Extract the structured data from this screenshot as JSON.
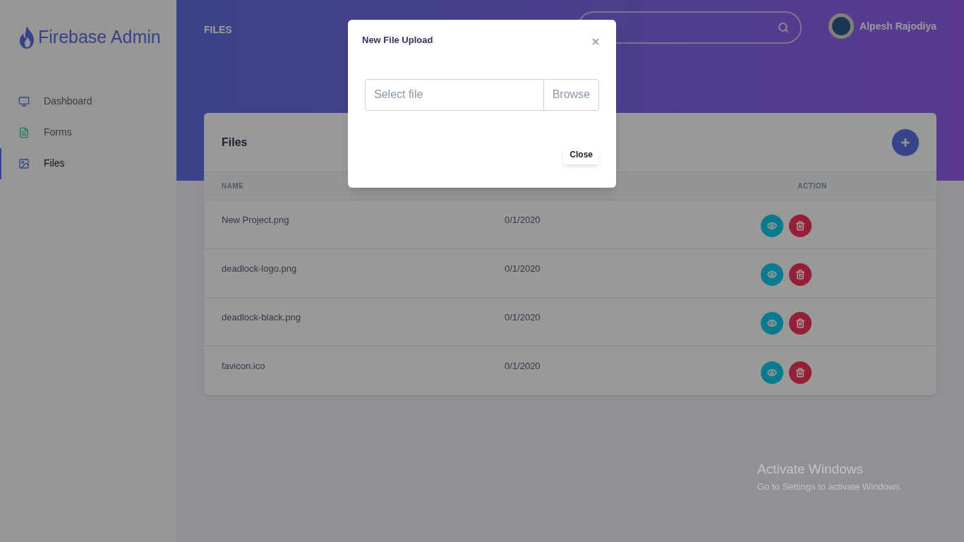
{
  "sidebar": {
    "brand": "Firebase Admin",
    "items": [
      {
        "label": "Dashboard",
        "kind": "dashboard",
        "selected": false
      },
      {
        "label": "Forms",
        "kind": "forms",
        "selected": false
      },
      {
        "label": "Files",
        "kind": "files",
        "selected": true
      }
    ]
  },
  "header": {
    "title": "FILES",
    "user": {
      "name": "Alpesh Rajodiya"
    }
  },
  "card": {
    "title": "Files",
    "table": {
      "columns": [
        {
          "label": "NAME"
        },
        {
          "label": "ACTION"
        }
      ],
      "rows": [
        {
          "name": "New Project.png",
          "date": "0/1/2020"
        },
        {
          "name": "deadlock-logo.png",
          "date": "0/1/2020"
        },
        {
          "name": "deadlock-black.png",
          "date": "0/1/2020"
        },
        {
          "name": "favicon.ico",
          "date": "0/1/2020"
        }
      ]
    }
  },
  "modal": {
    "title": "New File Upload",
    "file_field": {
      "placeholder": "Select file",
      "browse": "Browse"
    },
    "close_button": "Close"
  },
  "os_notice": {
    "title": "Activate Windows",
    "text": "Go to Settings to activate Windows."
  }
}
